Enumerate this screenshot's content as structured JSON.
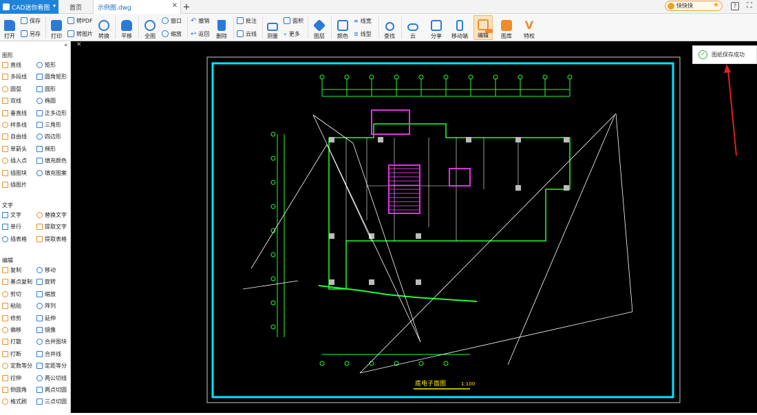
{
  "titlebar": {
    "app_name": "CAD迷你看图",
    "tabs": [
      {
        "label": "首页"
      },
      {
        "label": "示例图.dwg"
      }
    ],
    "add_tab": "+",
    "user_name": "快快快",
    "icons": {
      "help": "?",
      "fullscreen": "⛶"
    }
  },
  "toolbar": {
    "open": "打开",
    "save": "保存",
    "save_as": "另存",
    "print": "打印",
    "to_pdf": "转PDF",
    "to_image": "转图片",
    "convert": "转换",
    "pan": "平移",
    "fit_all": "全图",
    "window": "窗口",
    "zoom": "缩放",
    "undo": "撤销",
    "back": "返回",
    "delete": "删除",
    "annotate": "批注",
    "cloud_line": "云线",
    "measure": "测量",
    "area": "面积",
    "more": "更多",
    "layers": "图层",
    "color": "颜色",
    "line_width": "线宽",
    "line_type": "线型",
    "find": "查找",
    "cloud": "云",
    "share": "分享",
    "mobile": "移动端",
    "edit": "编辑",
    "library": "图库",
    "vip": "特权"
  },
  "sidebar": {
    "sections": [
      {
        "title": "图形",
        "items": [
          "直线",
          "矩形",
          "多段线",
          "圆角矩形",
          "圆弧",
          "圆形",
          "双线",
          "椭圆",
          "垂直线",
          "正多边形",
          "样条线",
          "三角形",
          "自由线",
          "四边形",
          "单箭头",
          "梯形",
          "插入点",
          "填充颜色",
          "插图块",
          "填充图案",
          "插图片"
        ]
      },
      {
        "title": "文字",
        "items": [
          "文字",
          "替换文字",
          "单行",
          "提取文字",
          "插表格",
          "提取表格"
        ]
      },
      {
        "title": "编辑",
        "items": [
          "复制",
          "移动",
          "基点复制",
          "旋转",
          "剪切",
          "缩放",
          "粘贴",
          "阵列",
          "修剪",
          "延伸",
          "偏移",
          "镜像",
          "打散",
          "合并图块",
          "打断",
          "合并线",
          "定数等分",
          "定距等分",
          "拉伸",
          "两公切线",
          "倒圆角",
          "两点切圆",
          "格式刷",
          "三点切圆"
        ]
      }
    ]
  },
  "drawing": {
    "title": "底电子面图",
    "scale": "1:100"
  },
  "toast": {
    "message": "图纸保存成功"
  },
  "colors": {
    "accent": "#1f83d8",
    "canvas": "#000000",
    "frame": "#00e5ff",
    "cad_green": "#22ff33",
    "cad_magenta": "#e033e0",
    "cad_yellow": "#ffea00",
    "arrow": "#e02020"
  }
}
